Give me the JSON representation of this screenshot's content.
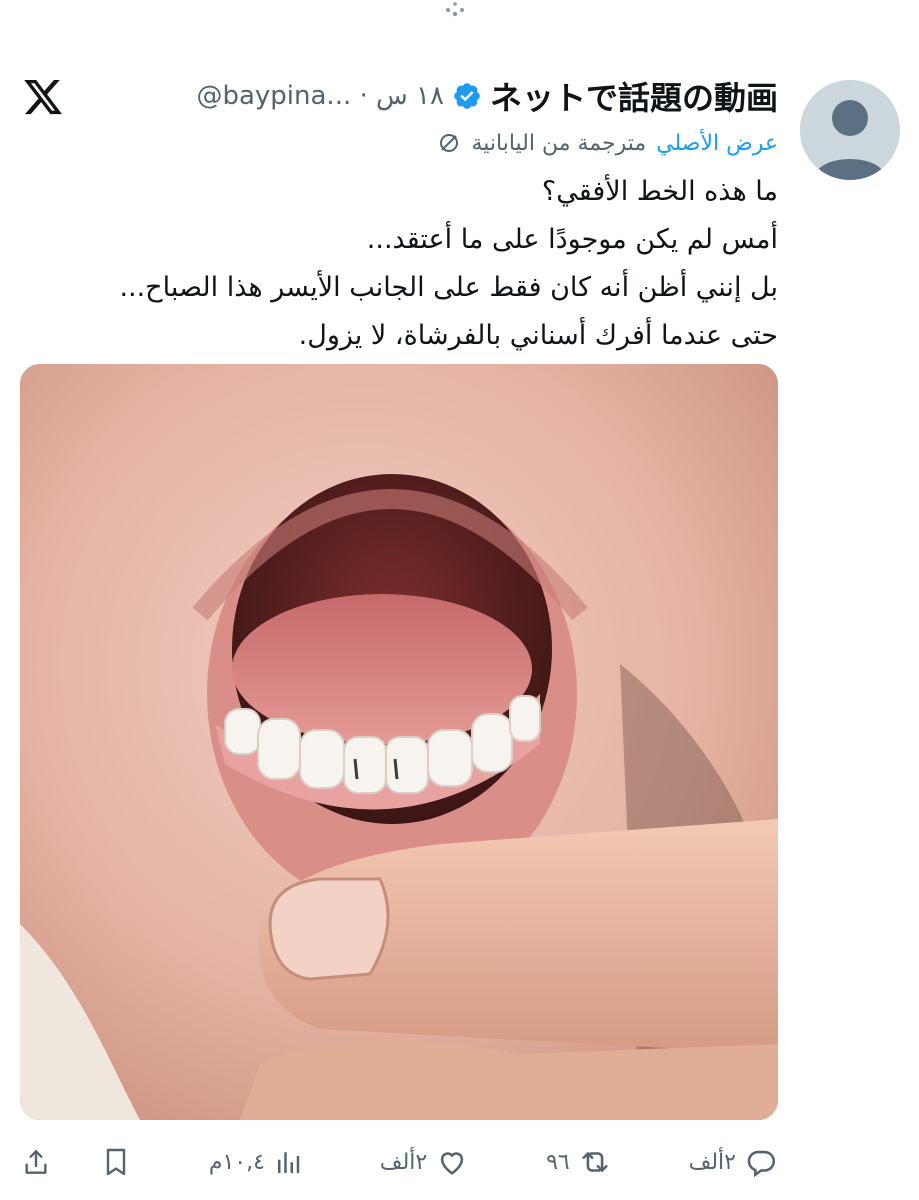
{
  "colors": {
    "accent": "#1d9bf0",
    "text": "#0f1419",
    "muted": "#536471"
  },
  "post": {
    "display_name": "ネットで話題の動画",
    "verified_icon": "verified-badge-icon",
    "handle_meta": "@baypina... · ١٨ س",
    "translation_note": "مترجمة من اليابانية",
    "show_original": "عرض الأصلي",
    "body_lines": [
      "ما هذه الخط الأفقي؟",
      "أمس لم يكن موجودًا على ما أعتقد...",
      "بل إنني أظن أنه كان فقط على الجانب الأيسر هذا الصباح...",
      "حتى عندما أفرك أسناني بالفرشاة، لا يزول."
    ]
  },
  "actions": {
    "reply_count": "٢ألف",
    "repost_count": "٩٦",
    "like_count": "٢ألف",
    "views_count": "١٠,٤م"
  },
  "icons": [
    "x-logo-icon",
    "reply-icon",
    "repost-icon",
    "like-icon",
    "views-icon",
    "bookmark-icon",
    "share-icon",
    "translate-icon",
    "default-avatar-icon"
  ]
}
